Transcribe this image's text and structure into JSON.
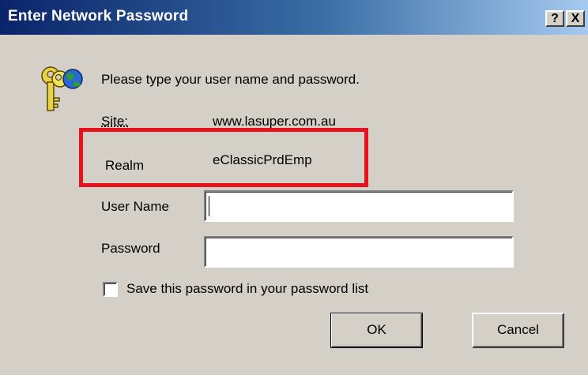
{
  "window": {
    "title": "Enter Network Password",
    "help_label": "?",
    "close_label": "X"
  },
  "icon": "keys-globe-icon",
  "prompt": "Please type your user name and password.",
  "site": {
    "label": "Site:",
    "value": "www.lasuper.com.au"
  },
  "realm": {
    "label": "Realm",
    "value": "eClassicPrdEmp"
  },
  "fields": {
    "user_name_label": "User Name",
    "user_name_value": "",
    "password_label": "Password",
    "password_value": ""
  },
  "save_checkbox": {
    "label": "Save this password in your password list",
    "checked": false
  },
  "buttons": {
    "ok": "OK",
    "cancel": "Cancel"
  },
  "colors": {
    "title_bar_start": "#0a246a",
    "title_bar_end": "#a6caf0",
    "dialog_bg": "#d4d0c8",
    "highlight": "#e8121e"
  }
}
